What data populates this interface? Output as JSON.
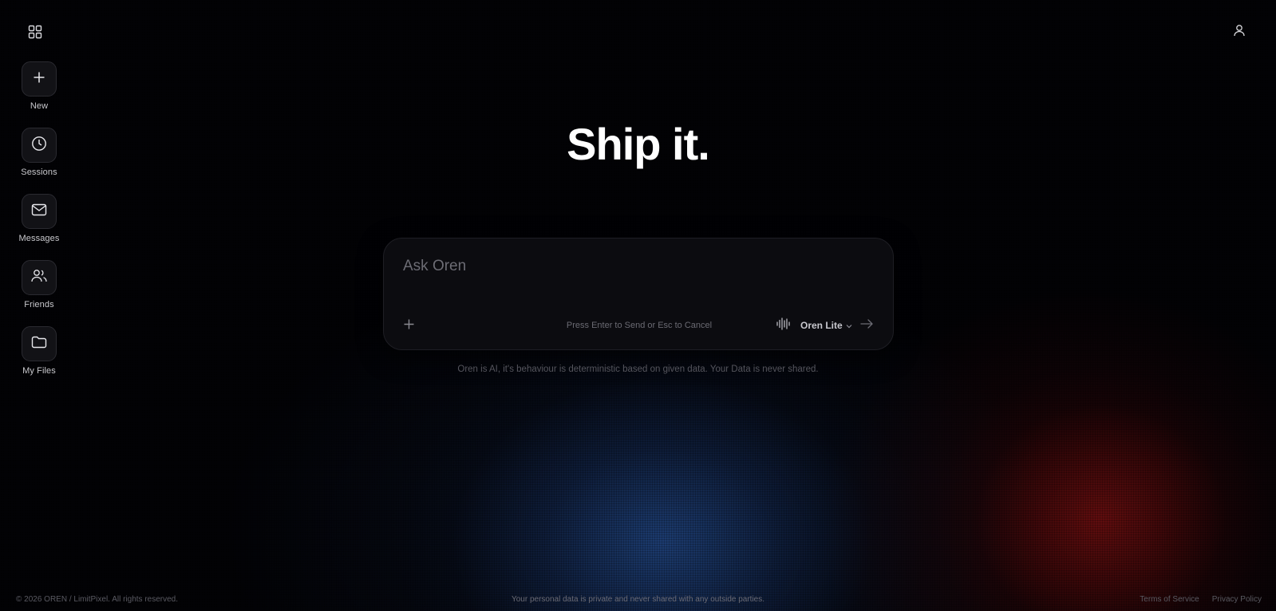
{
  "header": {
    "apps_icon": "grid-icon",
    "profile_icon": "user-icon"
  },
  "sidebar": {
    "items": [
      {
        "label": "New",
        "icon": "plus-icon"
      },
      {
        "label": "Sessions",
        "icon": "clock-icon"
      },
      {
        "label": "Messages",
        "icon": "mail-icon"
      },
      {
        "label": "Friends",
        "icon": "users-icon"
      },
      {
        "label": "My Files",
        "icon": "folder-icon"
      }
    ]
  },
  "hero": {
    "title": "Ship it."
  },
  "prompt": {
    "placeholder": "Ask Oren",
    "hint": "Press Enter to Send or Esc to Cancel",
    "model": "Oren Lite",
    "add_icon": "plus-icon",
    "voice_icon": "waveform-icon",
    "send_icon": "arrow-right-icon",
    "chevron_icon": "chevron-down-icon"
  },
  "disclaimer": "Oren is AI, it's behaviour is deterministic based on given data. Your Data is never shared.",
  "footer": {
    "copyright": "© 2026 OREN / LimitPixel. All rights reserved.",
    "privacy_note": "Your personal data is private and never shared with any outside parties.",
    "links": [
      "Terms of Service",
      "Privacy Policy"
    ]
  },
  "colors": {
    "background": "#000000",
    "tile": "#121216",
    "prompt_bg": "#0c0c10",
    "glow_blue": "#234b8c",
    "glow_red": "#961414"
  }
}
